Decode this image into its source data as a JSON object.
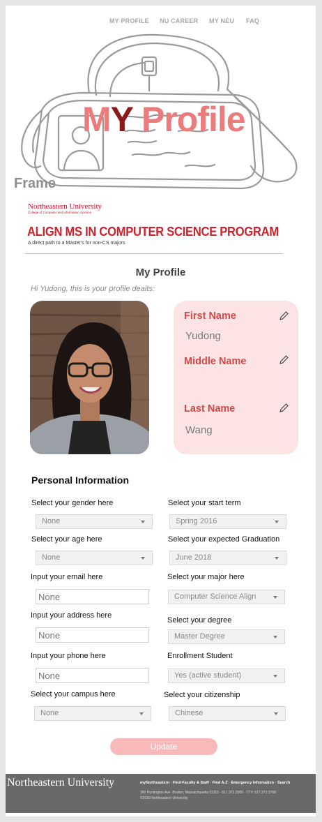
{
  "nav": {
    "items": [
      "MY PROFILE",
      "NU CAREER",
      "MY NEU",
      "FAQ"
    ]
  },
  "hero": {
    "title_m": "M",
    "title_y": "Y",
    "title_rest": " Profile",
    "frame_label": "Frame"
  },
  "brand": {
    "university": "Northeastern University",
    "college": "College of Computer and Information Science",
    "program_title": "ALIGN MS IN COMPUTER SCIENCE PROGRAM",
    "program_subtitle": "A direct path to a Master's for non-CS majors"
  },
  "profile": {
    "section_title": "My Profile",
    "greeting": "Hi Yudong, this is your profile dealts:",
    "first_name_label": "First Name",
    "first_name": "Yudong",
    "middle_name_label": "Middle Name",
    "middle_name": "",
    "last_name_label": "Last Name",
    "last_name": "Wang"
  },
  "personal": {
    "title": "Personal Information",
    "gender_label": "Select your gender here",
    "gender_value": "None",
    "start_term_label": "Select your start term",
    "start_term_value": "Spring 2016",
    "age_label": "Select your age here",
    "age_value": "None",
    "graduation_label": "Select your expected Graduation",
    "graduation_value": "June 2018",
    "email_label": "Input your email here",
    "email_value": "None",
    "major_label": "Select your major here",
    "major_value": "Computer Science Align",
    "address_label": "Input your address here",
    "address_value": "None",
    "degree_label": "Select your degree",
    "degree_value": "Master Degree",
    "phone_label": "Input your phone here",
    "phone_value": "None",
    "enrollment_label": "Enrollment Student",
    "enrollment_value": "Yes (active student)",
    "campus_label": "Select your campus here",
    "campus_value": "None",
    "citizenship_label": "Select your citizenship",
    "citizenship_value": "Chinese"
  },
  "actions": {
    "update_label": "Update"
  },
  "footer": {
    "logo": "Northeastern University",
    "links": [
      "myNortheastern",
      "Find Faculty & Staff",
      "Find A-Z",
      "Emergency Information",
      "Search"
    ],
    "separator": " · ",
    "address": "360 Huntington Ave. Boston, Massachusetts 02115 · 617.373.2000 · TTY: 617.373.3768",
    "copyright": "©2018 Northeastern University"
  },
  "colors": {
    "accent_red": "#d0202a",
    "hero_pink": "#ec7b7b",
    "card_pink": "#fce4e4",
    "button_pink": "#f7b9b9",
    "footer_gray": "#696969"
  }
}
